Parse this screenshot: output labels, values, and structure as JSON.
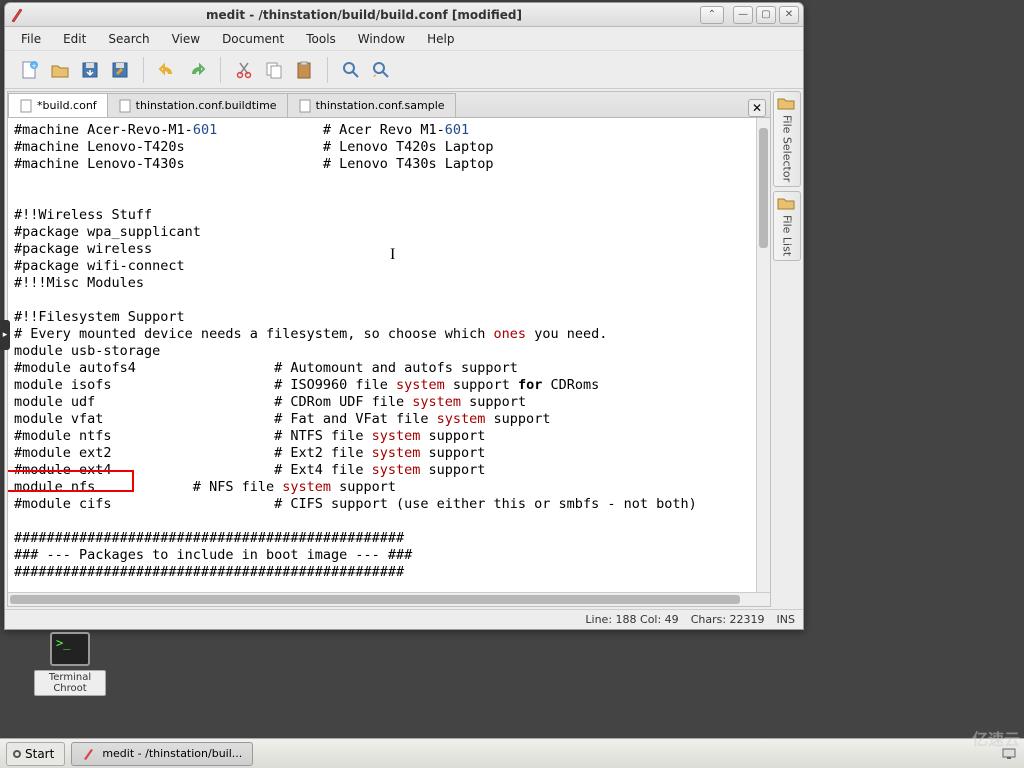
{
  "window": {
    "title": "medit - /thinstation/build/build.conf [modified]"
  },
  "menu": [
    "File",
    "Edit",
    "Search",
    "View",
    "Document",
    "Tools",
    "Window",
    "Help"
  ],
  "tabs": [
    {
      "label": "*build.conf",
      "active": true
    },
    {
      "label": "thinstation.conf.buildtime",
      "active": false
    },
    {
      "label": "thinstation.conf.sample",
      "active": false
    }
  ],
  "side": {
    "selector": "File Selector",
    "list": "File List"
  },
  "status": {
    "pos": "Line: 188 Col: 49",
    "chars": "Chars: 22319",
    "mode": "INS"
  },
  "desktop_icon": "Terminal Chroot",
  "taskbar": {
    "start": "Start",
    "task1": "medit - /thinstation/buil..."
  },
  "watermark": "亿速云",
  "chart_data": {
    "type": "table",
    "note": "Visible text content of the build.conf editor buffer",
    "lines": [
      "#machine Acer-Revo-M1-601             # Acer Revo M1-601",
      "#machine Lenovo-T420s                 # Lenovo T420s Laptop",
      "#machine Lenovo-T430s                 # Lenovo T430s Laptop",
      "",
      "",
      "#!!Wireless Stuff",
      "#package wpa_supplicant",
      "#package wireless",
      "#package wifi-connect",
      "#!!!Misc Modules",
      "",
      "#!!Filesystem Support",
      "# Every mounted device needs a filesystem, so choose which ones you need.",
      "module usb-storage",
      "#module autofs4                 # Automount and autofs support",
      "module isofs                    # ISO9960 file system support for CDRoms",
      "module udf                      # CDRom UDF file system support",
      "module vfat                     # Fat and VFat file system support",
      "#module ntfs                    # NTFS file system support",
      "#module ext2                    # Ext2 file system support",
      "#module ext4                    # Ext4 file system support",
      "module nfs            # NFS file system support",
      "#module cifs                    # CIFS support (use either this or smbfs - not both)",
      "",
      "################################################",
      "### --- Packages to include in boot image --- ###",
      "################################################"
    ]
  }
}
